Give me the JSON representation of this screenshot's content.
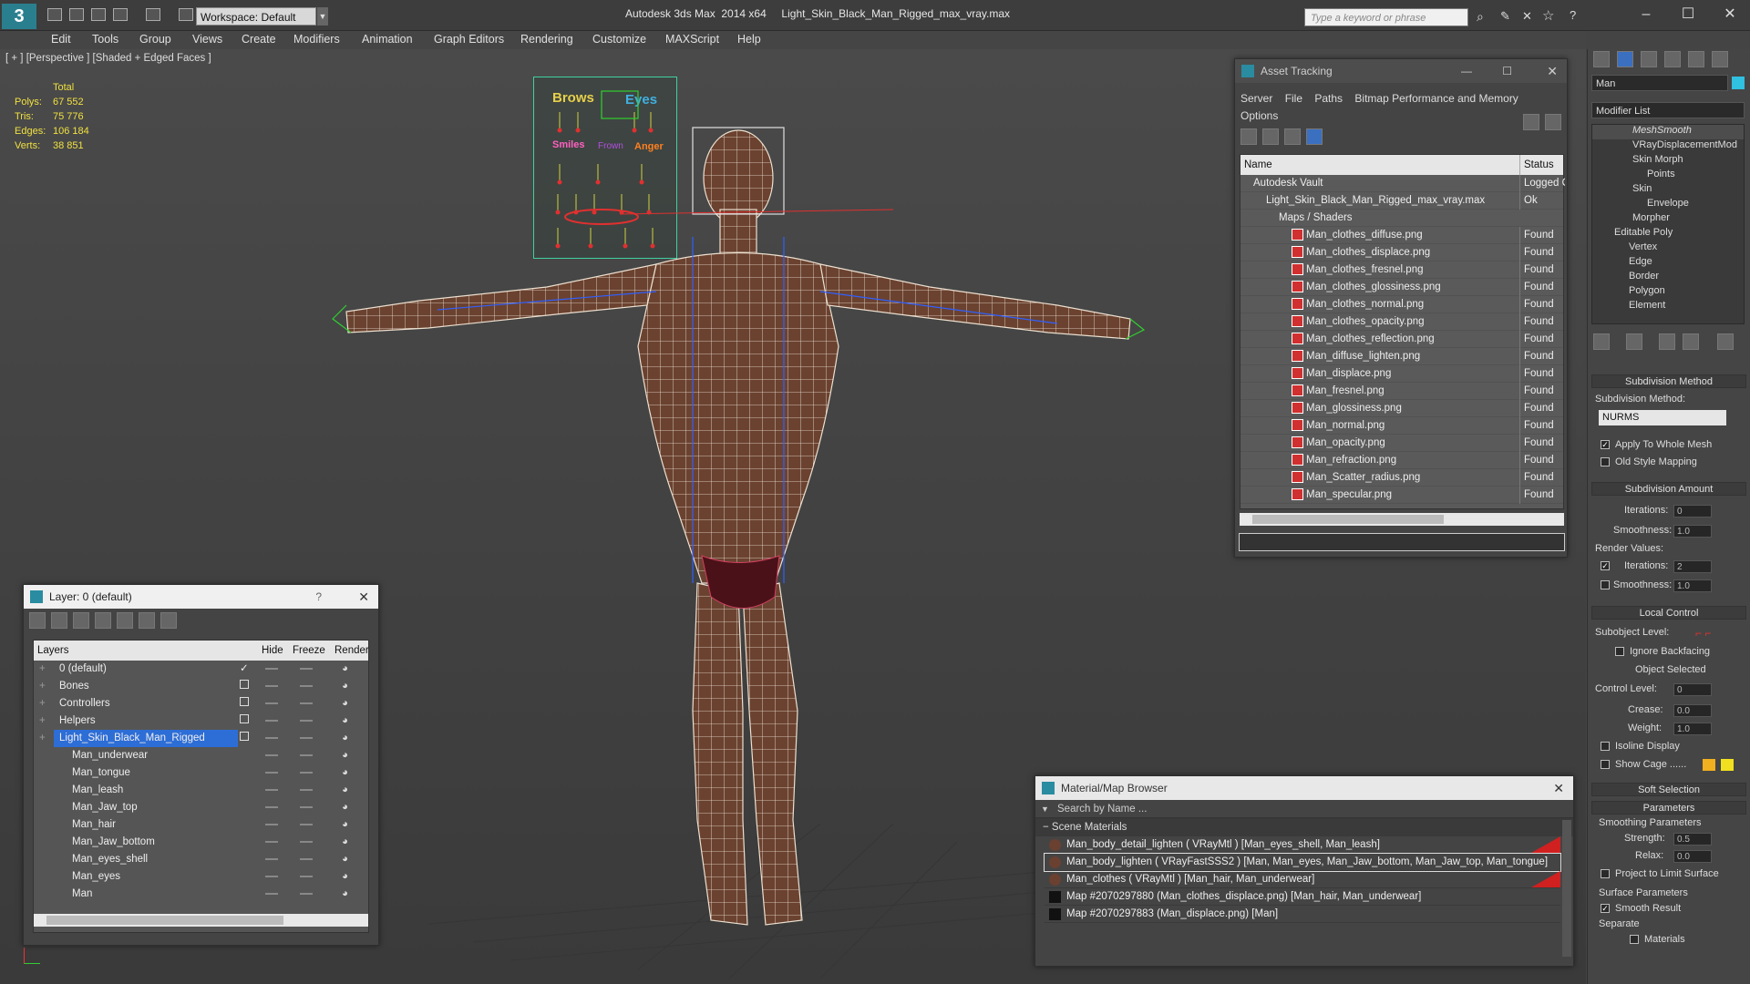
{
  "titlebar": {
    "workspace": "Workspace: Default",
    "title": "Autodesk 3ds Max  2014 x64     Light_Skin_Black_Man_Rigged_max_vray.max",
    "search_placeholder": "Type a keyword or phrase"
  },
  "menu": [
    "Edit",
    "Tools",
    "Group",
    "Views",
    "Create",
    "Modifiers",
    "Animation",
    "Graph Editors",
    "Rendering",
    "Customize",
    "MAXScript",
    "Help"
  ],
  "viewport": {
    "label": "[ + ] [Perspective ] [Shaded + Edged Faces ]",
    "stats_header": "Total",
    "stats": [
      {
        "label": "Polys:",
        "value": "67 552"
      },
      {
        "label": "Tris:",
        "value": "75 776"
      },
      {
        "label": "Edges:",
        "value": "106 184"
      },
      {
        "label": "Verts:",
        "value": "38 851"
      }
    ]
  },
  "face_board": {
    "brows": "Brows",
    "eyes": "Eyes",
    "smiles": "Smiles",
    "anger": "Anger",
    "frown": "Frown"
  },
  "asset": {
    "title": "Asset Tracking",
    "menu": [
      "Server",
      "File",
      "Paths",
      "Bitmap Performance and Memory",
      "Options"
    ],
    "col_name": "Name",
    "col_status": "Status",
    "rows": [
      {
        "name": "Autodesk Vault",
        "status": "Logged O",
        "indent": 1
      },
      {
        "name": "Light_Skin_Black_Man_Rigged_max_vray.max",
        "status": "Ok",
        "indent": 2
      },
      {
        "name": "Maps / Shaders",
        "status": "",
        "indent": 3
      },
      {
        "name": "Man_clothes_diffuse.png",
        "status": "Found",
        "indent": 4
      },
      {
        "name": "Man_clothes_displace.png",
        "status": "Found",
        "indent": 4
      },
      {
        "name": "Man_clothes_fresnel.png",
        "status": "Found",
        "indent": 4
      },
      {
        "name": "Man_clothes_glossiness.png",
        "status": "Found",
        "indent": 4
      },
      {
        "name": "Man_clothes_normal.png",
        "status": "Found",
        "indent": 4
      },
      {
        "name": "Man_clothes_opacity.png",
        "status": "Found",
        "indent": 4
      },
      {
        "name": "Man_clothes_reflection.png",
        "status": "Found",
        "indent": 4
      },
      {
        "name": "Man_diffuse_lighten.png",
        "status": "Found",
        "indent": 4
      },
      {
        "name": "Man_displace.png",
        "status": "Found",
        "indent": 4
      },
      {
        "name": "Man_fresnel.png",
        "status": "Found",
        "indent": 4
      },
      {
        "name": "Man_glossiness.png",
        "status": "Found",
        "indent": 4
      },
      {
        "name": "Man_normal.png",
        "status": "Found",
        "indent": 4
      },
      {
        "name": "Man_opacity.png",
        "status": "Found",
        "indent": 4
      },
      {
        "name": "Man_refraction.png",
        "status": "Found",
        "indent": 4
      },
      {
        "name": "Man_Scatter_radius.png",
        "status": "Found",
        "indent": 4
      },
      {
        "name": "Man_specular.png",
        "status": "Found",
        "indent": 4
      }
    ]
  },
  "layer": {
    "title": "Layer: 0 (default)",
    "help": "?",
    "cols": {
      "layers": "Layers",
      "hide": "Hide",
      "freeze": "Freeze",
      "render": "Render"
    },
    "rows": [
      {
        "name": "0 (default)",
        "indent": 1,
        "checked": true
      },
      {
        "name": "Bones",
        "indent": 1
      },
      {
        "name": "Controllers",
        "indent": 1
      },
      {
        "name": "Helpers",
        "indent": 1
      },
      {
        "name": "Light_Skin_Black_Man_Rigged",
        "indent": 1,
        "selected": true
      },
      {
        "name": "Man_underwear",
        "indent": 2
      },
      {
        "name": "Man_tongue",
        "indent": 2
      },
      {
        "name": "Man_leash",
        "indent": 2
      },
      {
        "name": "Man_Jaw_top",
        "indent": 2
      },
      {
        "name": "Man_hair",
        "indent": 2
      },
      {
        "name": "Man_Jaw_bottom",
        "indent": 2
      },
      {
        "name": "Man_eyes_shell",
        "indent": 2
      },
      {
        "name": "Man_eyes",
        "indent": 2
      },
      {
        "name": "Man",
        "indent": 2
      }
    ]
  },
  "matbrowser": {
    "title": "Material/Map Browser",
    "search": "Search by Name ...",
    "section": "Scene Materials",
    "rows": [
      {
        "text": "Man_body_detail_lighten  ( VRayMtl ) [Man_eyes_shell, Man_leash]",
        "kind": "sphere",
        "flag": true
      },
      {
        "text": "Man_body_lighten  ( VRayFastSSS2 ) [Man, Man_eyes, Man_Jaw_bottom, Man_Jaw_top, Man_tongue]",
        "kind": "sphere",
        "selected": true
      },
      {
        "text": "Man_clothes  ( VRayMtl ) [Man_hair, Man_underwear]",
        "kind": "sphere",
        "flag": true
      },
      {
        "text": "Map #2070297880 (Man_clothes_displace.png) [Man_hair, Man_underwear]",
        "kind": "map"
      },
      {
        "text": "Map #2070297883 (Man_displace.png) [Man]",
        "kind": "map"
      }
    ]
  },
  "cmd": {
    "object_name": "Man",
    "modifier_list": "Modifier List",
    "stack": [
      {
        "t": "MeshSmooth",
        "x": 44,
        "i": true
      },
      {
        "t": "VRayDisplacementMod",
        "x": 44
      },
      {
        "t": "Skin Morph",
        "x": 44
      },
      {
        "t": "Points",
        "x": 60
      },
      {
        "t": "Skin",
        "x": 44
      },
      {
        "t": "Envelope",
        "x": 60
      },
      {
        "t": "Morpher",
        "x": 44
      },
      {
        "t": "Editable Poly",
        "x": 24
      },
      {
        "t": "Vertex",
        "x": 40
      },
      {
        "t": "Edge",
        "x": 40
      },
      {
        "t": "Border",
        "x": 40
      },
      {
        "t": "Polygon",
        "x": 40
      },
      {
        "t": "Element",
        "x": 40
      }
    ],
    "subdiv_method_title": "Subdivision Method",
    "subdiv_method_label": "Subdivision Method:",
    "subdiv_method": "NURMS",
    "apply_whole": "Apply To Whole Mesh",
    "old_style": "Old Style Mapping",
    "subdiv_amount_title": "Subdivision Amount",
    "iterations_label": "Iterations:",
    "iterations": "0",
    "smoothness_label": "Smoothness:",
    "smoothness": "1.0",
    "render_values": "Render Values:",
    "r_iterations": "2",
    "r_smoothness": "1.0",
    "local_control": "Local Control",
    "subobject_level": "Subobject Level:",
    "ignore_backfacing": "Ignore Backfacing",
    "object_selected": "Object Selected",
    "control_level_label": "Control Level:",
    "control_level": "0",
    "crease_label": "Crease:",
    "crease": "0.0",
    "weight_label": "Weight:",
    "weight": "1.0",
    "isoline": "Isoline Display",
    "show_cage": "Show Cage ......",
    "soft_selection": "Soft Selection",
    "parameters": "Parameters",
    "smoothing_params": "Smoothing Parameters",
    "strength_label": "Strength:",
    "strength": "0.5",
    "relax_label": "Relax:",
    "relax": "0.0",
    "project": "Project to Limit Surface",
    "surface_params": "Surface Parameters",
    "smooth_result": "Smooth Result",
    "separate": "Separate",
    "materials": "Materials"
  }
}
